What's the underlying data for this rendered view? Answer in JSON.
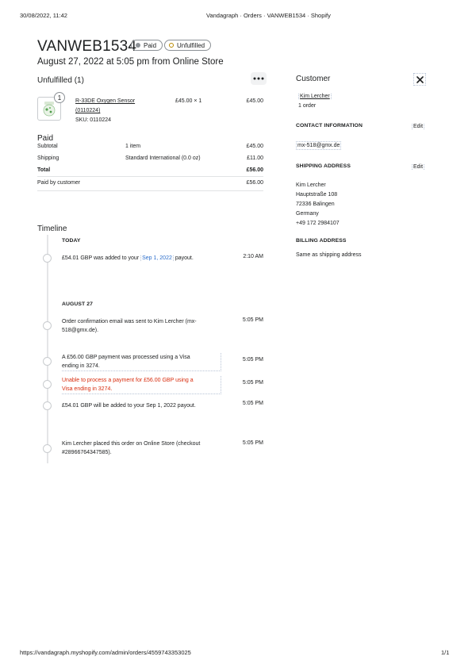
{
  "browser": {
    "datetime": "30/08/2022, 11:42",
    "page_title": "Vandagraph · Orders · VANWEB1534 · Shopify",
    "url": "https://vandagraph.myshopify.com/admin/orders/4559743353025",
    "page_count": "1/1"
  },
  "order": {
    "id": "VANWEB1534",
    "badges": {
      "paid": "Paid",
      "unfulfilled": "Unfulfilled"
    },
    "subtitle": "August 27, 2022 at 5:05 pm from Online Store"
  },
  "unfulfilled": {
    "title": "Unfulfilled (1)",
    "more_icon": "ellipsis-icon",
    "item": {
      "quantity_badge": "1",
      "name_line1": "R-33DE Oxygen Sensor",
      "name_line2": "(0110224)",
      "sku": "SKU: 0110224",
      "price_qty": "£45.00 × 1",
      "total": "£45.00"
    }
  },
  "payment": {
    "title": "Paid",
    "rows": [
      {
        "label": "Subtotal",
        "detail": "1 item",
        "amount": "£45.00"
      },
      {
        "label": "Shipping",
        "detail": "Standard International (0.0 oz)",
        "amount": "£11.00"
      },
      {
        "label": "Total",
        "detail": "",
        "amount": "£56.00"
      }
    ],
    "paid_by_label": "Paid by customer",
    "paid_by_amount": "£56.00"
  },
  "timeline": {
    "title": "Timeline",
    "today_label": "TODAY",
    "today_events": [
      {
        "pre": "£54.01 GBP was added to your ",
        "link": "Sep 1, 2022",
        "post": " payout.",
        "time": "2:10 AM"
      }
    ],
    "aug_label": "AUGUST 27",
    "aug_events": [
      {
        "line1": "Order confirmation email was sent to Kim Lercher (mx-",
        "line2": "518@gmx.de).",
        "time": "5:05 PM"
      },
      {
        "line1": "A £56.00 GBP payment was processed using a Visa",
        "line2": "ending in 3274.",
        "time": "5:05 PM"
      },
      {
        "line1": "Unable to process a payment for £56.00 GBP using a",
        "line2": "Visa ending in 3274.",
        "time": "5:05 PM"
      },
      {
        "line1": "£54.01 GBP will be added to your Sep 1, 2022 payout.",
        "line2": "",
        "time": "5:05 PM"
      },
      {
        "line1": "Kim Lercher placed this order on Online Store (checkout",
        "line2": "#28966764347585).",
        "time": "5:05 PM"
      }
    ],
    "error_color": "#d82c0d"
  },
  "customer": {
    "title": "Customer",
    "close_icon": "close-icon",
    "name": "Kim Lercher",
    "orders": "1 order",
    "contact_title": "CONTACT INFORMATION",
    "contact_edit": "Edit",
    "email": "mx-518@gmx.de",
    "shipping_title": "SHIPPING ADDRESS",
    "shipping_edit": "Edit",
    "address": [
      "Kim Lercher",
      "Hauptstraße 108",
      "72336 Balingen",
      "Germany",
      "+49 172 2984107"
    ],
    "billing_title": "BILLING ADDRESS",
    "billing_text": "Same as shipping address"
  },
  "colors": {
    "link_blue": "#2c6ecb",
    "paid_badge": "#8c9196",
    "unfulfilled_dot": "#b98900"
  }
}
